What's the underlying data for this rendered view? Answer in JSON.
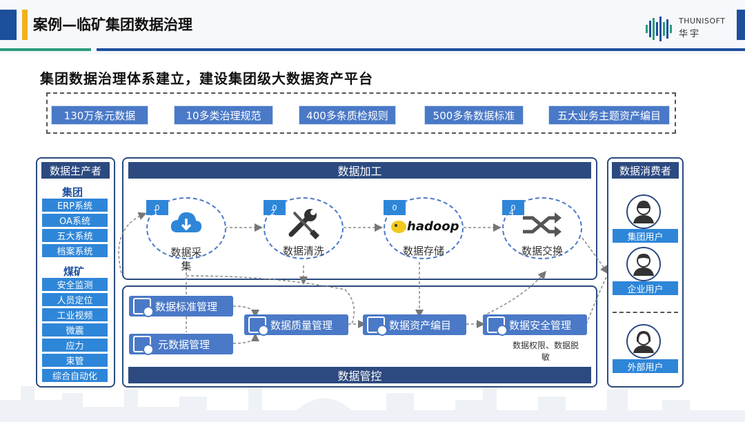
{
  "header": {
    "title": "案例—临矿集团数据治理",
    "logo_name": "THUNISOFT",
    "logo_cn": "华宇"
  },
  "subtitle": "集团数据治理体系建立，建设集团级大数据资产平台",
  "metrics": [
    "130万条元数据",
    "10多类治理规范",
    "400多条质检规则",
    "500多条数据标准",
    "五大业务主题资产编目"
  ],
  "producers": {
    "title": "数据生产者",
    "group1": {
      "title": "集团",
      "items": [
        "ERP系统",
        "OA系统",
        "五大系统",
        "档案系统"
      ]
    },
    "group2": {
      "title": "煤矿",
      "items": [
        "安全监测",
        "人员定位",
        "工业视频",
        "微震",
        "应力",
        "束管",
        "综合自动化"
      ]
    }
  },
  "processing": {
    "title": "数据加工",
    "steps": [
      {
        "tag": "0",
        "num": "1",
        "label": "数据采\n集"
      },
      {
        "tag": "0",
        "num": "2",
        "label": "数据清洗"
      },
      {
        "tag": "0",
        "num": "",
        "label": "数据存储",
        "logo": "hadoop"
      },
      {
        "tag": "0",
        "num": "4",
        "label": "数据交换"
      }
    ]
  },
  "governance": {
    "title": "数据管控",
    "modules": [
      "数据标准管理",
      "元数据管理",
      "数据质量管理",
      "数据资产编目",
      "数据安全管理"
    ],
    "security_note": "数据权限、数据脱\n敏"
  },
  "consumers": {
    "title": "数据消费者",
    "users": [
      "集团用户",
      "企业用户",
      "外部用户"
    ]
  },
  "colors": {
    "primary": "#2c4a80",
    "accent": "#4a79c7",
    "item": "#2e86d8",
    "yellow": "#f2b21c",
    "green": "#2a9c7a"
  }
}
